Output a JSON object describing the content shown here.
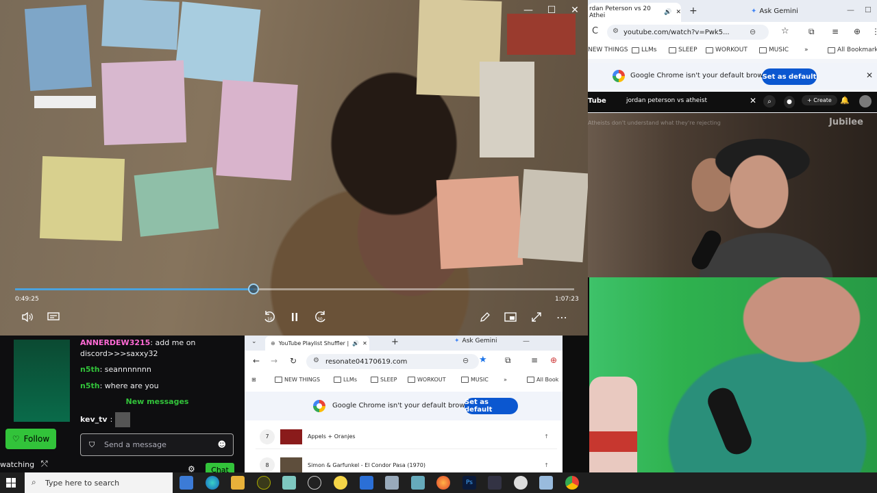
{
  "player": {
    "elapsed": "0:49:25",
    "duration": "1:07:23",
    "progress": 0.426,
    "skip_back_label": "10",
    "skip_fwd_label": "30"
  },
  "chrome_top": {
    "tab_title": "rdan Peterson vs 20 Athei",
    "tab2_title": "Ask Gemini",
    "url": "youtube.com/watch?v=Pwk5...",
    "bookmarks": [
      "NEW THINGS",
      "LLMs",
      "SLEEP",
      "WORKOUT",
      "MUSIC"
    ],
    "all_bookmarks": "All Bookmarks",
    "infobar_text": "Google Chrome isn't your default browser",
    "set_default": "Set as default",
    "yt_logo": "Tube",
    "yt_search": "jordan peterson vs atheist",
    "create_label": "Create"
  },
  "yt_video": {
    "caption": "Atheists don't understand what they're rejecting",
    "watermark": "Jubilee"
  },
  "chat": {
    "messages": [
      {
        "user": "ANNERDEW3215",
        "color": "#ff6ad5",
        "text": ": add me on discord>>>saxxy32"
      },
      {
        "user": "n5th",
        "color": "#32c33a",
        "text": ": seannnnnnn"
      },
      {
        "user": "n5th",
        "color": "#32c33a",
        "text": ": where are you"
      }
    ],
    "new_messages": "New messages",
    "kev_user": "kev_tv",
    "follow_label": "Follow",
    "input_placeholder": "Send a message",
    "watching_label": "watching",
    "chat_button": "Chat"
  },
  "chrome_bottom": {
    "tab_title": "YouTube Playlist Shuffler |",
    "tab2_title": "Ask Gemini",
    "url": "resonate04170619.com",
    "bookmarks": [
      "NEW THINGS",
      "LLMs",
      "SLEEP",
      "WORKOUT",
      "MUSIC"
    ],
    "all_bookmarks": "All Book",
    "infobar_text": "Google Chrome isn't your default browser",
    "set_default": "Set as default",
    "playlist": [
      {
        "num": "7",
        "title": "Appels + Oranjes"
      },
      {
        "num": "8",
        "title": "Simon & Garfunkel - El Condor Pasa (1970)"
      }
    ]
  },
  "taskbar": {
    "search_placeholder": "Type here to search"
  },
  "colors": {
    "twitch_green": "#32c33a",
    "chrome_blue": "#0b57d0",
    "seek_blue": "#4aa3df"
  }
}
